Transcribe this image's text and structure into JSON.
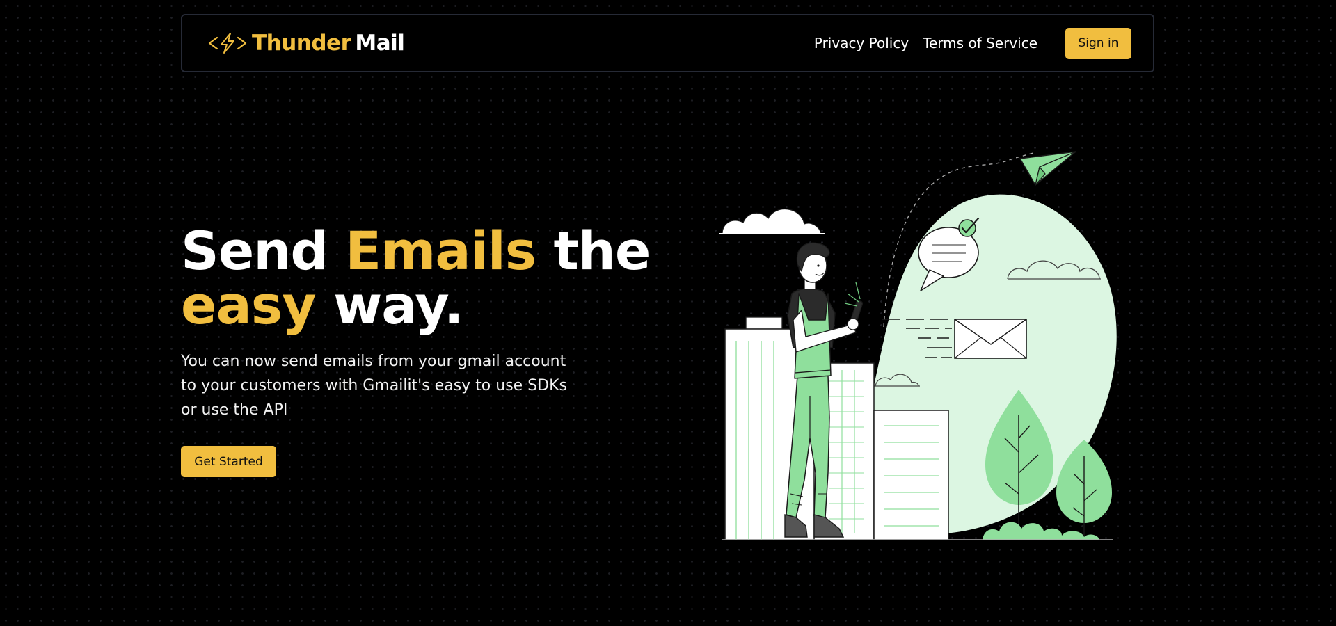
{
  "brand": {
    "thunder": "Thunder",
    "mail": "Mail",
    "accent_color": "#f1be3f",
    "logo_icon": "lightning-bolt-code-icon"
  },
  "nav": {
    "links": [
      "Privacy Policy",
      "Terms of Service"
    ],
    "signin_label": "Sign in"
  },
  "hero": {
    "headline": {
      "word1": "Send",
      "word2": "Emails",
      "word3": "the",
      "word4": "easy",
      "word5": "way."
    },
    "subtitle": "You can now send emails from your gmail account to your customers with Gmailit's easy to use SDKs or use the API",
    "cta_label": "Get Started"
  },
  "illustration": {
    "illustration_palette": {
      "green": "#8fdf9c",
      "mint": "#dcf6e2",
      "outline": "#1a1a1a"
    }
  },
  "colors": {
    "background": "#000000",
    "button": "#f1be3f",
    "navbar_border": "#262a36"
  }
}
